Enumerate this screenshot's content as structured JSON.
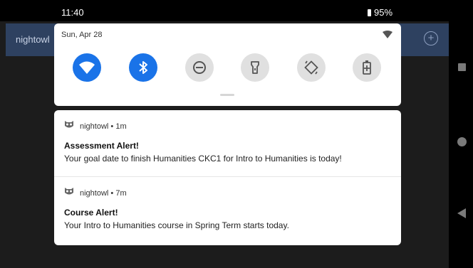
{
  "status_bar": {
    "time": "11:40",
    "battery": "95%"
  },
  "app": {
    "title": "nightowl"
  },
  "quick_settings": {
    "date": "Sun, Apr 28",
    "tiles": [
      {
        "name": "wifi",
        "active": true
      },
      {
        "name": "bluetooth",
        "active": true
      },
      {
        "name": "do-not-disturb",
        "active": false
      },
      {
        "name": "flashlight",
        "active": false
      },
      {
        "name": "auto-rotate",
        "active": false
      },
      {
        "name": "battery-saver",
        "active": false
      }
    ]
  },
  "notifications": [
    {
      "app": "nightowl",
      "time": "1m",
      "title": "Assessment Alert!",
      "text": "Your goal date to finish Humanities CKC1 for Intro to Humanities is today!"
    },
    {
      "app": "nightowl",
      "time": "7m",
      "title": "Course Alert!",
      "text": "Your Intro to Humanities course in Spring Term starts today."
    }
  ],
  "colors": {
    "accent": "#1a73e8",
    "app_bar": "#2e4160",
    "background": "#1c1c1c"
  }
}
